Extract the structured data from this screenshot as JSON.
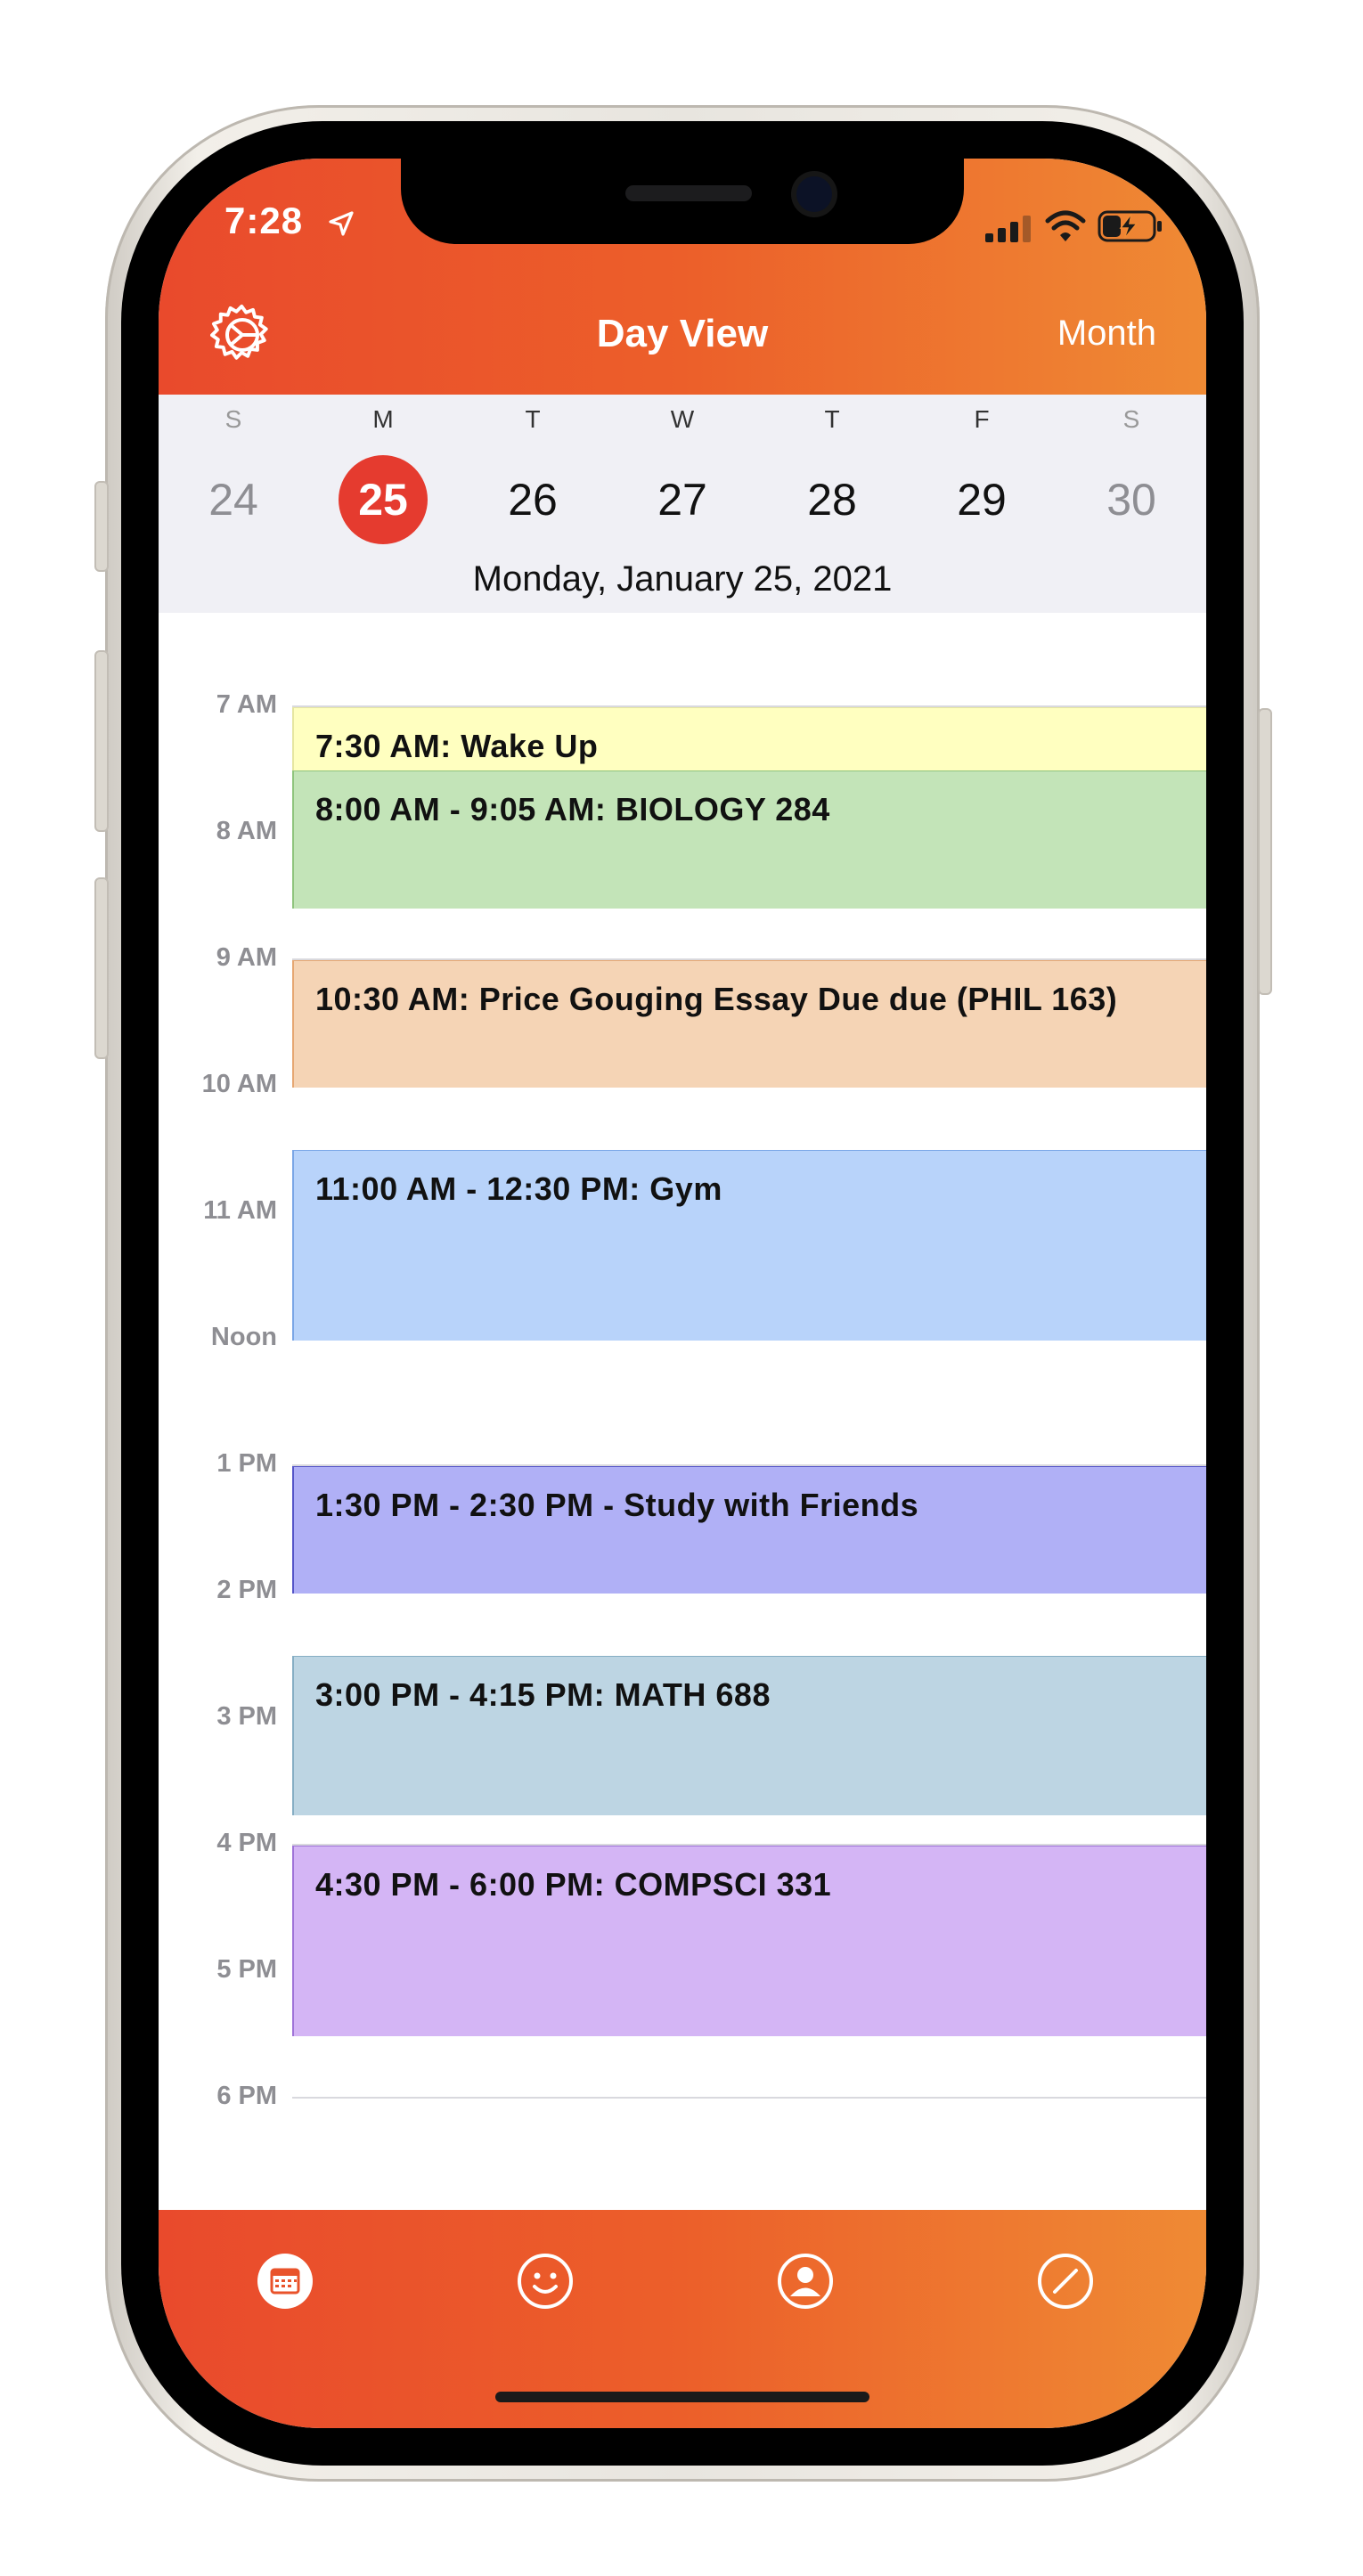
{
  "status_bar": {
    "time": "7:28"
  },
  "header": {
    "title": "Day View",
    "month_button": "Month"
  },
  "week": {
    "days": [
      {
        "dow": "S",
        "num": "24",
        "weekend": true,
        "selected": false
      },
      {
        "dow": "M",
        "num": "25",
        "weekend": false,
        "selected": true
      },
      {
        "dow": "T",
        "num": "26",
        "weekend": false,
        "selected": false
      },
      {
        "dow": "W",
        "num": "27",
        "weekend": false,
        "selected": false
      },
      {
        "dow": "T",
        "num": "28",
        "weekend": false,
        "selected": false
      },
      {
        "dow": "F",
        "num": "29",
        "weekend": false,
        "selected": false
      },
      {
        "dow": "S",
        "num": "30",
        "weekend": true,
        "selected": false
      }
    ],
    "selected_date": "Monday, January 25, 2021"
  },
  "hours": [
    "7 AM",
    "8 AM",
    "9 AM",
    "10 AM",
    "11 AM",
    "Noon",
    "1 PM",
    "2 PM",
    "3 PM",
    "4 PM",
    "5 PM",
    "6 PM"
  ],
  "events": [
    {
      "title": "7:30 AM: Wake Up",
      "start": 7.5,
      "end": 8.5,
      "color": "#ffffc0",
      "border": "#e6e6a0"
    },
    {
      "title": "8:00 AM - 9:05 AM: BIOLOGY 284",
      "start": 8.0,
      "end": 9.083,
      "color": "#c3e4b8",
      "border": "#8fc47d"
    },
    {
      "title": "10:30 AM: Price Gouging Essay Due due (PHIL 163)",
      "start": 9.5,
      "end": 10.5,
      "color": "#f5d4b5",
      "border": "#e6a772"
    },
    {
      "title": "11:00 AM - 12:30 PM: Gym",
      "start": 11.0,
      "end": 12.5,
      "color": "#b8d3fa",
      "border": "#7aa6e6"
    },
    {
      "title": "1:30 PM - 2:30 PM - Study with Friends",
      "start": 13.5,
      "end": 14.5,
      "color": "#b0b0f6",
      "border": "#5555c8"
    },
    {
      "title": "3:00 PM - 4:15 PM: MATH 688",
      "start": 15.0,
      "end": 16.25,
      "color": "#bdd5e3",
      "border": "#86aec4"
    },
    {
      "title": "4:30 PM - 6:00 PM: COMPSCI 331",
      "start": 16.5,
      "end": 18.0,
      "color": "#d4b5f5",
      "border": "#9f73d8"
    }
  ],
  "tabs": [
    {
      "name": "calendar-tab",
      "icon": "calendar-icon",
      "active": true
    },
    {
      "name": "smiley-tab",
      "icon": "smiley-icon",
      "active": false
    },
    {
      "name": "profile-tab",
      "icon": "person-icon",
      "active": false
    },
    {
      "name": "compass-tab",
      "icon": "compass-icon",
      "active": false
    }
  ],
  "theme": {
    "accent": "#e53b2f",
    "gradient_start": "#e94a2c",
    "gradient_end": "#ef8a34"
  }
}
